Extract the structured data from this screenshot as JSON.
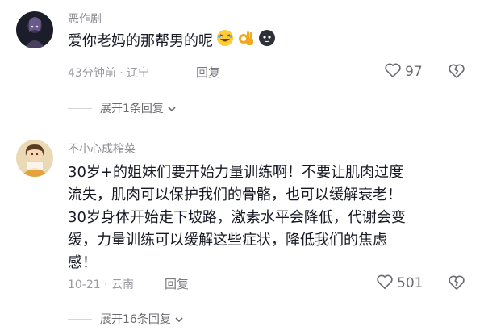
{
  "comments": [
    {
      "username": "恶作剧",
      "text": "爱你老妈的那帮男的呢",
      "emojis": [
        "rolling-laughing-emoji",
        "ok-hand-emoji",
        "black-blob-emoji"
      ],
      "meta": "43分钟前 · 辽宁",
      "reply_label": "回复",
      "likes": "97",
      "expand_label": "展开1条回复"
    },
    {
      "username": "不小心成榨菜",
      "text_lines": [
        "30岁+的姐妹们要开始力量训练啊！不要让肌肉过度",
        "流失，肌肉可以保护我们的骨骼，也可以缓解衰老！",
        "30岁身体开始走下坡路，激素水平会降低，代谢会变",
        "缓，力量训练可以缓解这些症状，降低我们的焦虑",
        "感！"
      ],
      "meta": "10-21 · 云南",
      "reply_label": "回复",
      "likes": "501",
      "expand_label": "展开16条回复"
    }
  ],
  "icons": {
    "like": "heart-outline-icon",
    "dislike": "broken-heart-icon",
    "expand": "chevron-down-icon"
  },
  "colors": {
    "text": "#161823",
    "secondary": "#9a9ba0",
    "username": "#8a8b91"
  }
}
